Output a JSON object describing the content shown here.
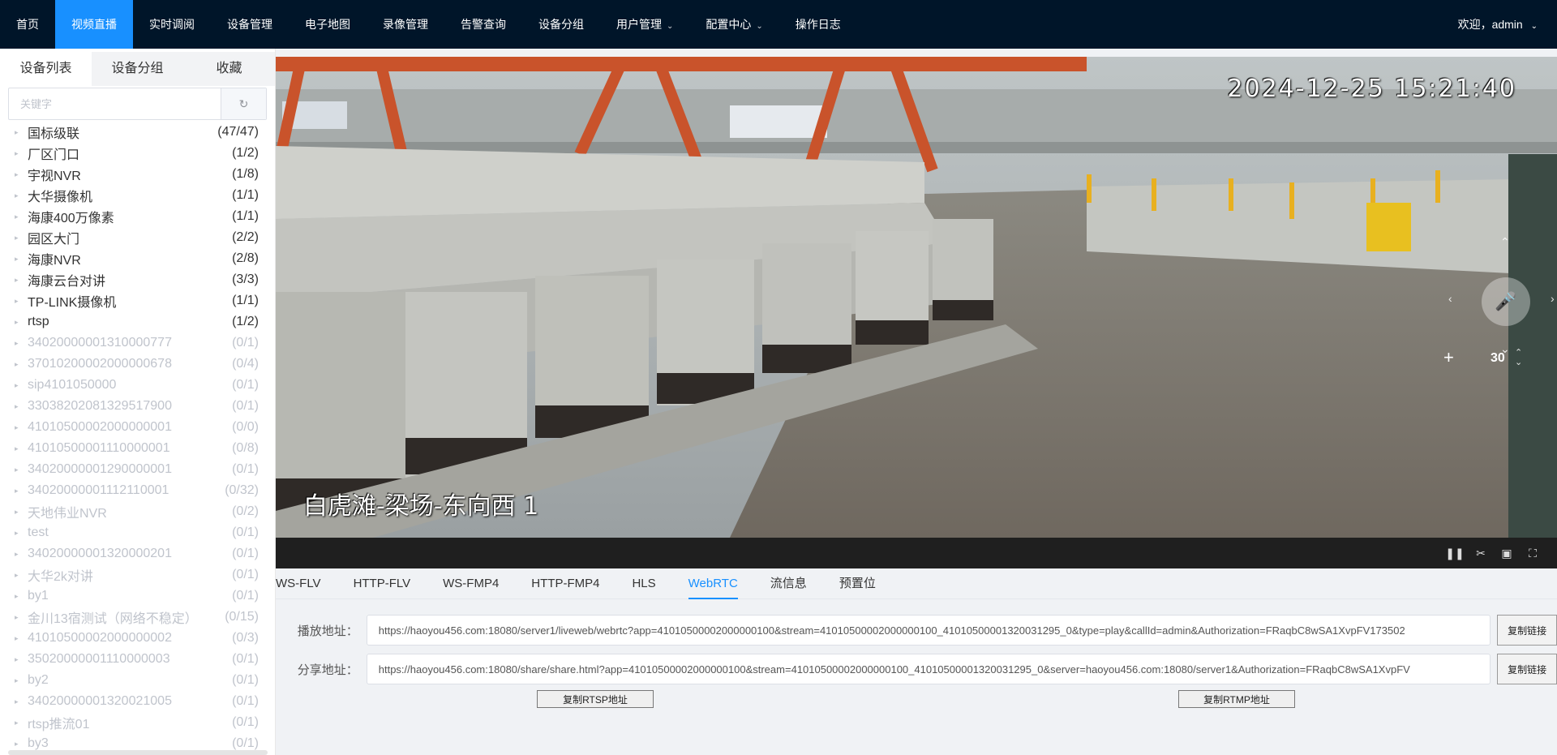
{
  "nav": {
    "items": [
      {
        "label": "首页",
        "active": false,
        "dropdown": false
      },
      {
        "label": "视频直播",
        "active": true,
        "dropdown": false
      },
      {
        "label": "实时调阅",
        "active": false,
        "dropdown": false
      },
      {
        "label": "设备管理",
        "active": false,
        "dropdown": false
      },
      {
        "label": "电子地图",
        "active": false,
        "dropdown": false
      },
      {
        "label": "录像管理",
        "active": false,
        "dropdown": false
      },
      {
        "label": "告警查询",
        "active": false,
        "dropdown": false
      },
      {
        "label": "设备分组",
        "active": false,
        "dropdown": false
      },
      {
        "label": "用户管理",
        "active": false,
        "dropdown": true
      },
      {
        "label": "配置中心",
        "active": false,
        "dropdown": true
      },
      {
        "label": "操作日志",
        "active": false,
        "dropdown": false
      }
    ],
    "welcome": "欢迎，admin"
  },
  "sidebar": {
    "tabs": [
      "设备列表",
      "设备分组",
      "收藏"
    ],
    "active_tab": 0,
    "search_placeholder": "关键字",
    "items": [
      {
        "name": "国标级联",
        "count": "(47/47)",
        "online": true
      },
      {
        "name": "厂区门口",
        "count": "(1/2)",
        "online": true
      },
      {
        "name": "宇视NVR",
        "count": "(1/8)",
        "online": true
      },
      {
        "name": "大华摄像机",
        "count": "(1/1)",
        "online": true
      },
      {
        "name": "海康400万像素",
        "count": "(1/1)",
        "online": true
      },
      {
        "name": "园区大门",
        "count": "(2/2)",
        "online": true
      },
      {
        "name": "海康NVR",
        "count": "(2/8)",
        "online": true
      },
      {
        "name": "海康云台对讲",
        "count": "(3/3)",
        "online": true
      },
      {
        "name": "TP-LINK摄像机",
        "count": "(1/1)",
        "online": true
      },
      {
        "name": "rtsp",
        "count": "(1/2)",
        "online": true
      },
      {
        "name": "34020000001310000777",
        "count": "(0/1)",
        "online": false
      },
      {
        "name": "37010200002000000678",
        "count": "(0/4)",
        "online": false
      },
      {
        "name": "sip4101050000",
        "count": "(0/1)",
        "online": false
      },
      {
        "name": "33038202081329517900",
        "count": "(0/1)",
        "online": false
      },
      {
        "name": "41010500002000000001",
        "count": "(0/0)",
        "online": false
      },
      {
        "name": "41010500001110000001",
        "count": "(0/8)",
        "online": false
      },
      {
        "name": "34020000001290000001",
        "count": "(0/1)",
        "online": false
      },
      {
        "name": "34020000001112110001",
        "count": "(0/32)",
        "online": false
      },
      {
        "name": "天地伟业NVR",
        "count": "(0/2)",
        "online": false
      },
      {
        "name": "test",
        "count": "(0/1)",
        "online": false
      },
      {
        "name": "34020000001320000201",
        "count": "(0/1)",
        "online": false
      },
      {
        "name": "大华2k对讲",
        "count": "(0/1)",
        "online": false
      },
      {
        "name": "by1",
        "count": "(0/1)",
        "online": false
      },
      {
        "name": "金川13宿测试（网络不稳定）",
        "count": "(0/15)",
        "online": false
      },
      {
        "name": "41010500002000000002",
        "count": "(0/3)",
        "online": false
      },
      {
        "name": "35020000001110000003",
        "count": "(0/1)",
        "online": false
      },
      {
        "name": "by2",
        "count": "(0/1)",
        "online": false
      },
      {
        "name": "34020000001320021005",
        "count": "(0/1)",
        "online": false
      },
      {
        "name": "rtsp推流01",
        "count": "(0/1)",
        "online": false
      },
      {
        "name": "by3",
        "count": "(0/1)",
        "online": false
      }
    ]
  },
  "video": {
    "osd_time": "2024-12-25 15:21:40",
    "osd_name": "白虎滩-梁场-东向西 1",
    "ptz_speed": "30",
    "controls": [
      "pause-icon",
      "scissors-icon",
      "record-icon",
      "fullscreen-icon"
    ]
  },
  "player_tabs": {
    "items": [
      "WS-FLV",
      "HTTP-FLV",
      "WS-FMP4",
      "HTTP-FMP4",
      "HLS",
      "WebRTC",
      "流信息",
      "预置位"
    ],
    "active": 5
  },
  "urls": {
    "play_label": "播放地址：",
    "play_url": "https://haoyou456.com:18080/server1/liveweb/webrtc?app=41010500002000000100&stream=41010500002000000100_41010500001320031295_0&type=play&callId=admin&Authorization=FRaqbC8wSA1XvpFV173502",
    "share_label": "分享地址：",
    "share_url": "https://haoyou456.com:18080/share/share.html?app=41010500002000000100&stream=41010500002000000100_41010500001320031295_0&server=haoyou456.com:18080/server1&Authorization=FRaqbC8wSA1XvpFV",
    "copy_label": "复制链接",
    "copy_rtsp": "复制RTSP地址",
    "copy_rtmp": "复制RTMP地址"
  },
  "colors": {
    "nav_bg": "#001529",
    "accent": "#1890ff",
    "offline_text": "#c0c4cc"
  }
}
